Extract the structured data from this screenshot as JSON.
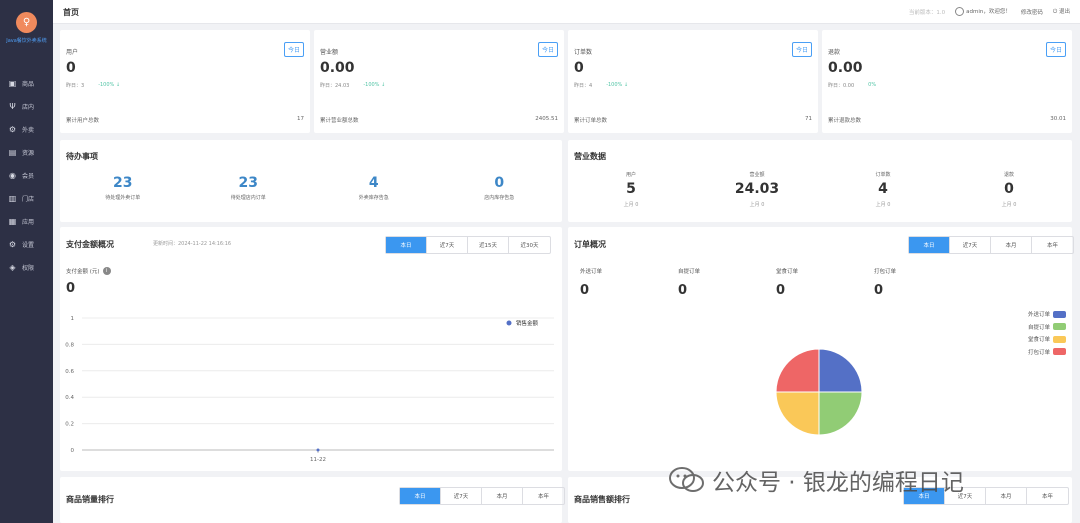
{
  "brand": {
    "logo_glyph": "♀",
    "name": "Java餐饮外卖系统"
  },
  "sidebar": {
    "items": [
      {
        "label": "商品",
        "icon": "box-icon",
        "glyph": "▣"
      },
      {
        "label": "店内",
        "icon": "fork-knife-icon",
        "glyph": "Ψ"
      },
      {
        "label": "外卖",
        "icon": "bike-icon",
        "glyph": "⚙"
      },
      {
        "label": "资源",
        "icon": "document-icon",
        "glyph": "▤"
      },
      {
        "label": "会员",
        "icon": "user-icon",
        "glyph": "◉"
      },
      {
        "label": "门店",
        "icon": "store-icon",
        "glyph": "▥"
      },
      {
        "label": "应用",
        "icon": "apps-icon",
        "glyph": "▦"
      },
      {
        "label": "设置",
        "icon": "gear-icon",
        "glyph": "⚙"
      },
      {
        "label": "权限",
        "icon": "shield-icon",
        "glyph": "◈"
      }
    ]
  },
  "header": {
    "title": "首页",
    "switch_label": "当前版本：1.0",
    "user_text": "admin，欢迎您！",
    "change_pwd": "修改密码",
    "logout": "退出"
  },
  "stats": [
    {
      "label": "用户",
      "value": "0",
      "yesterday": "昨日：3",
      "pct": "-100% ↓",
      "foot_label": "累计用户总数",
      "foot_value": "17",
      "badge": "今日"
    },
    {
      "label": "营业额",
      "value": "0.00",
      "yesterday": "昨日：24.03",
      "pct": "-100% ↓",
      "foot_label": "累计营业额总数",
      "foot_value": "2405.51",
      "badge": "今日"
    },
    {
      "label": "订单数",
      "value": "0",
      "yesterday": "昨日：4",
      "pct": "-100% ↓",
      "foot_label": "累计订单总数",
      "foot_value": "71",
      "badge": "今日"
    },
    {
      "label": "退款",
      "value": "0.00",
      "yesterday": "昨日：0.00",
      "pct": "0%",
      "foot_label": "累计退款总数",
      "foot_value": "30.01",
      "badge": "今日"
    }
  ],
  "todo": {
    "title": "待办事项",
    "items": [
      {
        "num": "23",
        "label": "待处理外卖订单"
      },
      {
        "num": "23",
        "label": "待处理店内订单"
      },
      {
        "num": "4",
        "label": "外卖库存告急"
      },
      {
        "num": "0",
        "label": "店内库存告急"
      }
    ]
  },
  "business": {
    "title": "营业数据",
    "items": [
      {
        "label": "用户",
        "value": "5",
        "prev": "上月 0"
      },
      {
        "label": "营业额",
        "value": "24.03",
        "prev": "上月 0"
      },
      {
        "label": "订单数",
        "value": "4",
        "prev": "上月 0"
      },
      {
        "label": "退款",
        "value": "0",
        "prev": "上月 0"
      }
    ]
  },
  "payment": {
    "title": "支付金额概况",
    "update_time": "更新时间：2024-11-22 14:16:16",
    "tabs": [
      "本日",
      "近7天",
      "近15天",
      "近30天"
    ],
    "metric_label": "支付金额 (元)",
    "metric_value": "0",
    "info_glyph": "i"
  },
  "orders": {
    "title": "订单概况",
    "tabs": [
      "本日",
      "近7天",
      "本月",
      "本年"
    ],
    "items": [
      {
        "label": "外送订单",
        "value": "0"
      },
      {
        "label": "自提订单",
        "value": "0"
      },
      {
        "label": "堂食订单",
        "value": "0"
      },
      {
        "label": "打包订单",
        "value": "0"
      }
    ]
  },
  "sales_rank": {
    "title": "商品销量排行",
    "tabs": [
      "本日",
      "近7天",
      "本月",
      "本年"
    ]
  },
  "revenue_rank": {
    "title": "商品销售额排行",
    "tabs": [
      "本日",
      "近7天",
      "本月",
      "本年"
    ]
  },
  "watermark": {
    "text": "公众号 · 银龙的编程日记"
  },
  "colors": {
    "accent": "#3b97f0",
    "sidebar": "#2d3045",
    "pie_blue": "#5470c6",
    "pie_green": "#91cc75",
    "pie_yellow": "#fac858",
    "pie_red": "#ee6666"
  },
  "chart_data": [
    {
      "type": "line",
      "title": "",
      "x": [
        "11-22"
      ],
      "series": [
        {
          "name": "销售金额",
          "values": [
            0
          ]
        }
      ],
      "ylim": [
        0,
        1
      ],
      "yticks": [
        "0",
        "0.2",
        "0.4",
        "0.6",
        "0.8",
        "1"
      ],
      "grid": true,
      "legend": "top-right"
    },
    {
      "type": "pie",
      "categories": [
        "外送订单",
        "自提订单",
        "堂食订单",
        "打包订单"
      ],
      "values": [
        25,
        25,
        25,
        25
      ],
      "legend": "right"
    }
  ]
}
